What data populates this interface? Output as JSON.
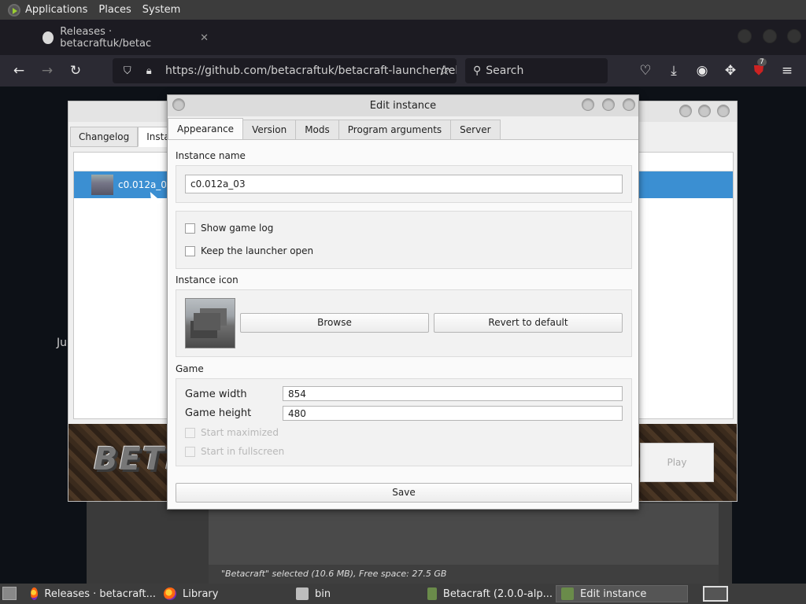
{
  "top_panel": {
    "menus": [
      "Applications",
      "Places",
      "System"
    ]
  },
  "browser": {
    "tab_title": "Releases · betacraftuk/betac",
    "tab_close": "✕",
    "url": "https://github.com/betacraftuk/betacraft-launcher/rele",
    "search_placeholder": "Search",
    "ublock_badge": "7"
  },
  "page": {
    "ghost_heading": "Ju",
    "status_text": "\"Betacraft\" selected (10.6 MB), Free space: 27.5 GB"
  },
  "launcher": {
    "tabs": [
      "Changelog",
      "Instan"
    ],
    "selected_instance": "c0.012a_03",
    "logo_text": "BETI",
    "play_label": "Play"
  },
  "dialog": {
    "title": "Edit instance",
    "tabs": [
      "Appearance",
      "Version",
      "Mods",
      "Program arguments",
      "Server"
    ],
    "instance_name_label": "Instance name",
    "instance_name_value": "c0.012a_03",
    "show_game_log": "Show game log",
    "keep_launcher_open": "Keep the launcher open",
    "instance_icon_label": "Instance icon",
    "browse_label": "Browse",
    "revert_label": "Revert to default",
    "game_label": "Game",
    "game_width_label": "Game width",
    "game_width_value": "854",
    "game_height_label": "Game height",
    "game_height_value": "480",
    "start_maximized": "Start maximized",
    "start_fullscreen": "Start in fullscreen",
    "save_label": "Save"
  },
  "taskbar": {
    "items": [
      "Releases · betacraft...",
      "Library",
      "bin",
      "Betacraft (2.0.0-alp...",
      "Edit instance"
    ]
  }
}
